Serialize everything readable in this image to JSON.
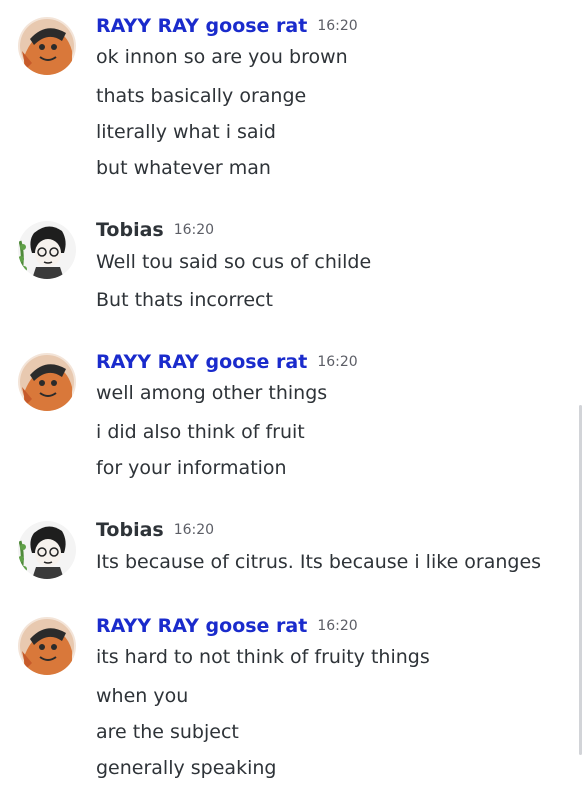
{
  "colors": {
    "rayy_name": "#1a2bcc",
    "tobias_name": "#2e3338",
    "text": "#2e3338",
    "timestamp": "#5c5e66"
  },
  "messages": [
    {
      "author": "RAYY RAY goose rat",
      "avatar_icon": "rayy-avatar-icon",
      "timestamp": "16:20",
      "lines": [
        "ok innon so are you brown",
        "thats basically orange",
        "literally what i said",
        "but whatever man"
      ]
    },
    {
      "author": "Tobias",
      "avatar_icon": "tobias-avatar-icon",
      "timestamp": "16:20",
      "lines": [
        "Well tou said so cus of childe",
        "But thats incorrect"
      ]
    },
    {
      "author": "RAYY RAY goose rat",
      "avatar_icon": "rayy-avatar-icon",
      "timestamp": "16:20",
      "lines": [
        "well among other things",
        "i did also think of fruit",
        "for your information"
      ]
    },
    {
      "author": "Tobias",
      "avatar_icon": "tobias-avatar-icon",
      "timestamp": "16:20",
      "lines": [
        "Its because of citrus. Its because i like oranges"
      ]
    },
    {
      "author": "RAYY RAY goose rat",
      "avatar_icon": "rayy-avatar-icon",
      "timestamp": "16:20",
      "lines": [
        "its hard to not think of fruity things",
        "when you",
        "are the subject",
        "generally speaking"
      ]
    }
  ]
}
